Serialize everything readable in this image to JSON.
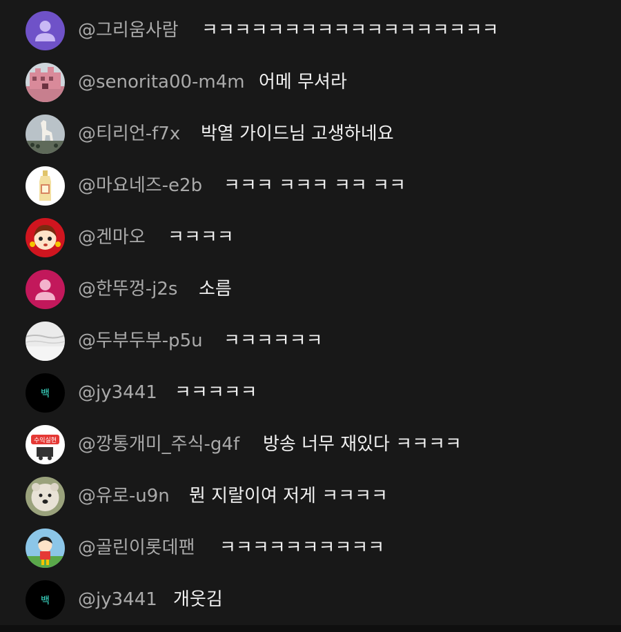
{
  "comments": [
    {
      "author": "@그리움사람",
      "text": "ㅋㅋㅋㅋㅋㅋㅋㅋㅋㅋㅋㅋㅋㅋㅋㅋㅋㅋ",
      "avatar": "default-avatar-icon",
      "avatar_color": "#6f52c8"
    },
    {
      "author": "@senorita00-m4m",
      "text": "어메 무셔라",
      "avatar": "pink-building-photo-icon",
      "avatar_color": "#d98a9a"
    },
    {
      "author": "@티리언-f7x",
      "text": "박열 가이드님 고생하네요",
      "avatar": "llama-statue-photo-icon",
      "avatar_color": "#9aa3a8"
    },
    {
      "author": "@마요네즈-e2b",
      "text": "ㅋㅋㅋ ㅋㅋㅋ ㅋㅋ ㅋㅋ",
      "avatar": "mayonnaise-bottle-icon",
      "avatar_color": "#ffffff"
    },
    {
      "author": "@겐마오",
      "text": "ㅋㅋㅋㅋ",
      "avatar": "peko-girl-icon",
      "avatar_color": "#d0151f"
    },
    {
      "author": "@한뚜껑-j2s",
      "text": "소름",
      "avatar": "default-avatar-icon",
      "avatar_color": "#c2185b"
    },
    {
      "author": "@두부두부-p5u",
      "text": "ㅋㅋㅋㅋㅋㅋ",
      "avatar": "snow-photo-icon",
      "avatar_color": "#e6e6e6"
    },
    {
      "author": "@jy3441",
      "text": "ㅋㅋㅋㅋㅋ",
      "avatar": "text-avatar-baek",
      "avatar_label": "백",
      "avatar_color": "#000000"
    },
    {
      "author": "@깡통개미_주식-g4f",
      "text": "방송 너무 재있다 ㅋㅋㅋㅋ",
      "avatar": "stock-logo-icon",
      "avatar_color": "#ffffff"
    },
    {
      "author": "@유로-u9n",
      "text": "뭔 지랄이여 저게 ㅋㅋㅋㅋ",
      "avatar": "polar-bear-photo-icon",
      "avatar_color": "#d9d3c8"
    },
    {
      "author": "@골린이롯데팬",
      "text": "ㅋㅋㅋㅋㅋㅋㅋㅋㅋㅋ",
      "avatar": "cartoon-boy-golf-icon",
      "avatar_color": "#8cc6e8"
    },
    {
      "author": "@jy3441",
      "text": "개웃김",
      "avatar": "text-avatar-baek",
      "avatar_label": "백",
      "avatar_color": "#000000"
    }
  ],
  "stock_logo_text": "수익실현"
}
